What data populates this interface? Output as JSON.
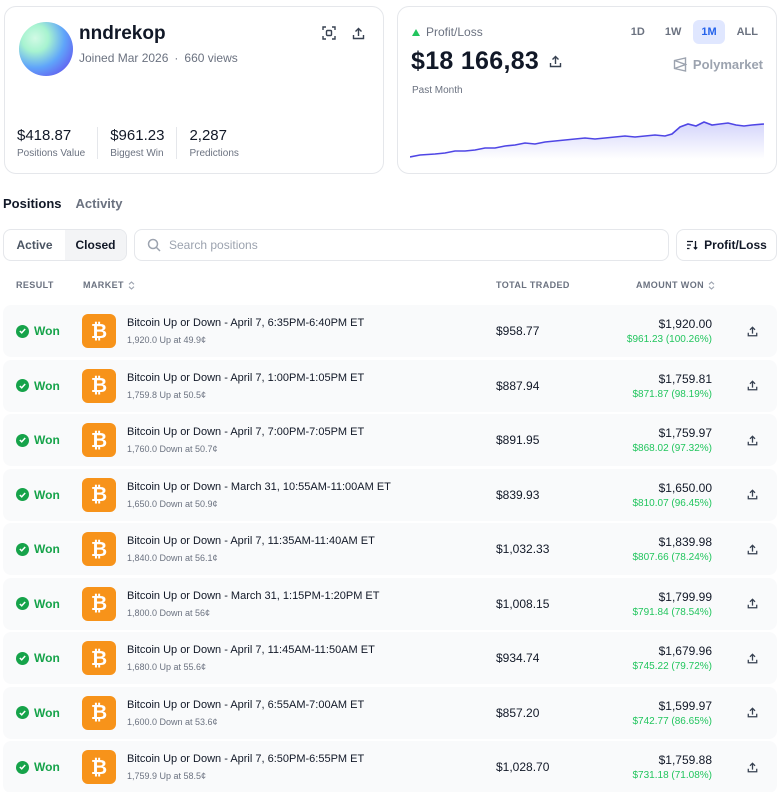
{
  "profile": {
    "username": "nndrekop",
    "joined": "Joined Mar 2026",
    "views": "660 views",
    "stats": [
      {
        "value": "$418.87",
        "label": "Positions Value"
      },
      {
        "value": "$961.23",
        "label": "Biggest Win"
      },
      {
        "value": "2,287",
        "label": "Predictions"
      }
    ]
  },
  "pnl": {
    "label": "Profit/Loss",
    "value": "$18 166,83",
    "period": "Past Month",
    "ranges": [
      "1D",
      "1W",
      "1M",
      "ALL"
    ],
    "active_range": "1M",
    "brand": "Polymarket",
    "line_color": "#4f46e5"
  },
  "tabs": {
    "positions": "Positions",
    "activity": "Activity"
  },
  "filter": {
    "active": "Active",
    "closed": "Closed"
  },
  "search": {
    "placeholder": "Search positions"
  },
  "sort": {
    "label": "Profit/Loss"
  },
  "table": {
    "headers": {
      "result": "RESULT",
      "market": "MARKET",
      "traded": "TOTAL TRADED",
      "won": "AMOUNT WON"
    },
    "rows": [
      {
        "result": "Won",
        "title": "Bitcoin Up or Down - April 7, 6:35PM-6:40PM ET",
        "sub": "1,920.0 Up at 49.9¢",
        "traded": "$958.77",
        "won": "$1,920.00",
        "pnl": "$961.23 (100.26%)"
      },
      {
        "result": "Won",
        "title": "Bitcoin Up or Down - April 7, 1:00PM-1:05PM ET",
        "sub": "1,759.8 Up at 50.5¢",
        "traded": "$887.94",
        "won": "$1,759.81",
        "pnl": "$871.87 (98.19%)"
      },
      {
        "result": "Won",
        "title": "Bitcoin Up or Down - April 7, 7:00PM-7:05PM ET",
        "sub": "1,760.0 Down at 50.7¢",
        "traded": "$891.95",
        "won": "$1,759.97",
        "pnl": "$868.02 (97.32%)"
      },
      {
        "result": "Won",
        "title": "Bitcoin Up or Down - March 31, 10:55AM-11:00AM ET",
        "sub": "1,650.0 Down at 50.9¢",
        "traded": "$839.93",
        "won": "$1,650.00",
        "pnl": "$810.07 (96.45%)"
      },
      {
        "result": "Won",
        "title": "Bitcoin Up or Down - April 7, 11:35AM-11:40AM ET",
        "sub": "1,840.0 Down at 56.1¢",
        "traded": "$1,032.33",
        "won": "$1,839.98",
        "pnl": "$807.66 (78.24%)"
      },
      {
        "result": "Won",
        "title": "Bitcoin Up or Down - March 31, 1:15PM-1:20PM ET",
        "sub": "1,800.0 Down at 56¢",
        "traded": "$1,008.15",
        "won": "$1,799.99",
        "pnl": "$791.84 (78.54%)"
      },
      {
        "result": "Won",
        "title": "Bitcoin Up or Down - April 7, 11:45AM-11:50AM ET",
        "sub": "1,680.0 Up at 55.6¢",
        "traded": "$934.74",
        "won": "$1,679.96",
        "pnl": "$745.22 (79.72%)"
      },
      {
        "result": "Won",
        "title": "Bitcoin Up or Down - April 7, 6:55AM-7:00AM ET",
        "sub": "1,600.0 Down at 53.6¢",
        "traded": "$857.20",
        "won": "$1,599.97",
        "pnl": "$742.77 (86.65%)"
      },
      {
        "result": "Won",
        "title": "Bitcoin Up or Down - April 7, 6:50PM-6:55PM ET",
        "sub": "1,759.9 Up at 58.5¢",
        "traded": "$1,028.70",
        "won": "$1,759.88",
        "pnl": "$731.18 (71.08%)"
      }
    ]
  }
}
